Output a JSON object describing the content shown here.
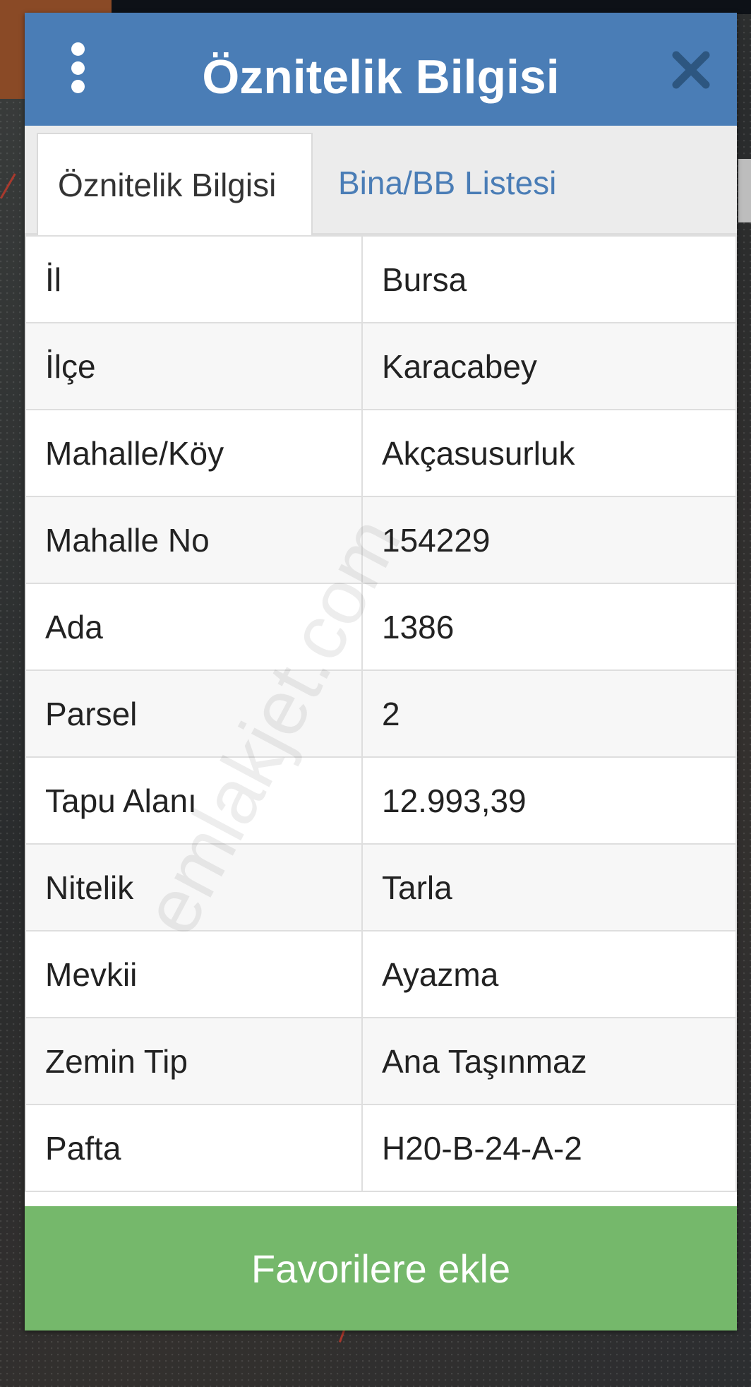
{
  "dialog": {
    "title": "Öznitelik Bilgisi",
    "header_color": "#4a7db6",
    "menu_icon": "more-vertical-icon",
    "close_icon": "close-icon"
  },
  "tabs": [
    {
      "label": "Öznitelik Bilgisi",
      "active": true
    },
    {
      "label": "Bina/BB Listesi",
      "active": false
    }
  ],
  "attributes": [
    {
      "key": "İl",
      "value": "Bursa"
    },
    {
      "key": "İlçe",
      "value": "Karacabey"
    },
    {
      "key": "Mahalle/Köy",
      "value": "Akçasusurluk"
    },
    {
      "key": "Mahalle No",
      "value": "154229"
    },
    {
      "key": "Ada",
      "value": "1386"
    },
    {
      "key": "Parsel",
      "value": "2"
    },
    {
      "key": "Tapu Alanı",
      "value": "12.993,39"
    },
    {
      "key": "Nitelik",
      "value": "Tarla"
    },
    {
      "key": "Mevkii",
      "value": "Ayazma"
    },
    {
      "key": "Zemin Tip",
      "value": "Ana Taşınmaz"
    },
    {
      "key": "Pafta",
      "value": "H20-B-24-A-2"
    }
  ],
  "watermark": "emlakjet.com",
  "favorite_button": {
    "label": "Favorilere ekle",
    "color": "#75b86b"
  }
}
